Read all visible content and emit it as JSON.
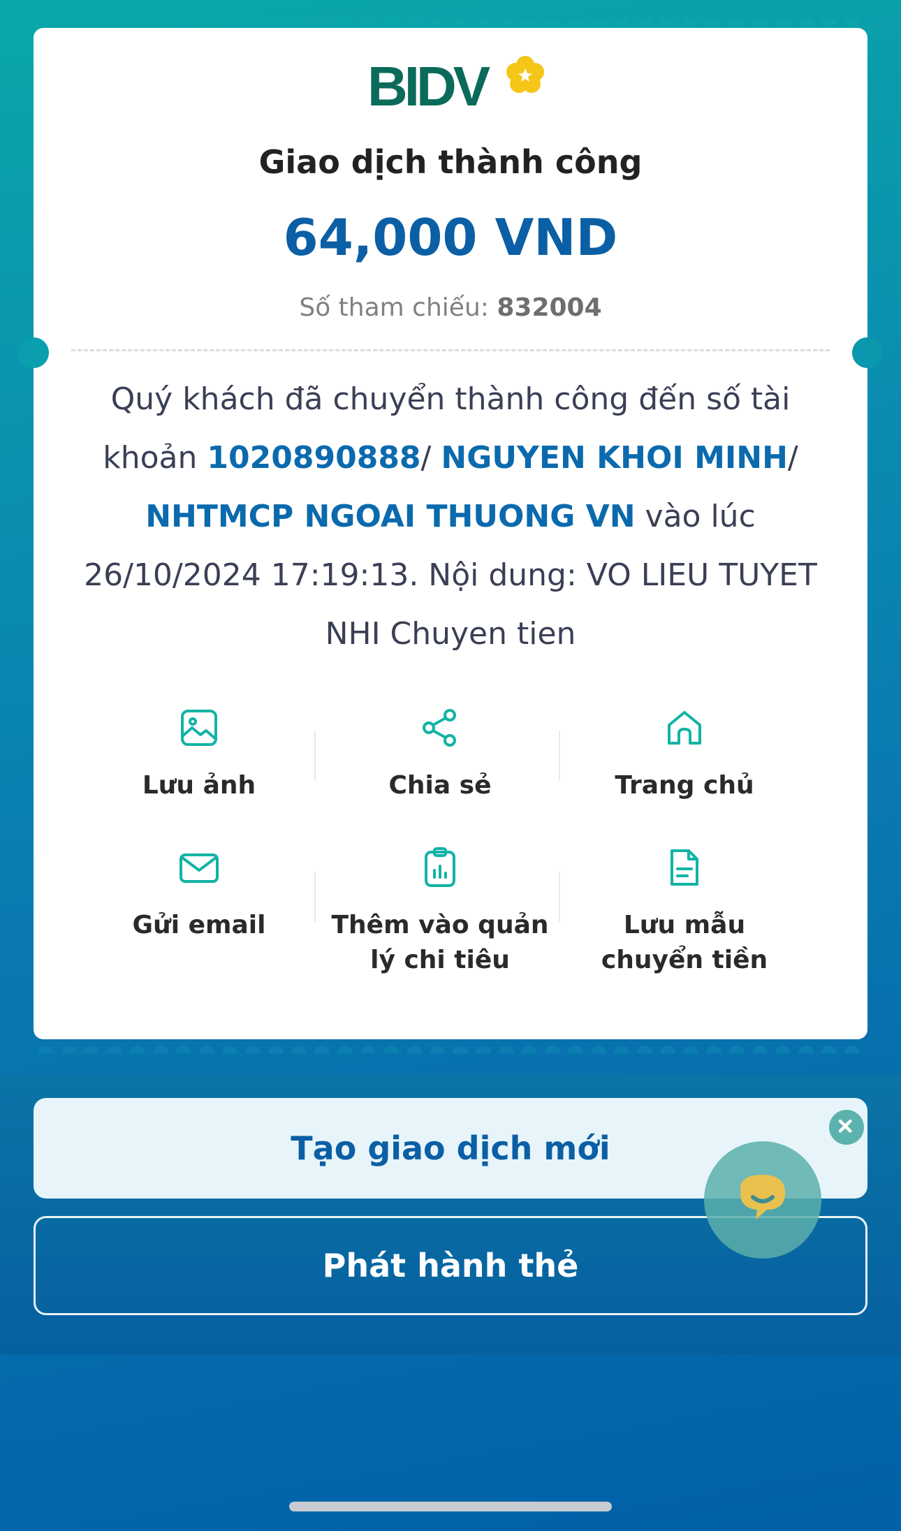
{
  "brand": {
    "name": "BIDV"
  },
  "receipt": {
    "title": "Giao dịch thành công",
    "amount": "64,000 VND",
    "reference_label": "Số tham chiếu:",
    "reference_value": "832004",
    "message": {
      "prefix": "Quý khách đã chuyển thành công đến số tài khoản ",
      "account": "1020890888",
      "sep1": "/ ",
      "recipient": "NGUYEN KHOI MINH",
      "sep2": "/ ",
      "bank": "NHTMCP NGOAI THUONG VN",
      "suffix": " vào lúc 26/10/2024 17:19:13. Nội dung: VO LIEU TUYET NHI Chuyen tien"
    }
  },
  "actions": [
    {
      "label": "Lưu ảnh",
      "icon": "image-icon"
    },
    {
      "label": "Chia sẻ",
      "icon": "share-icon"
    },
    {
      "label": "Trang chủ",
      "icon": "home-icon"
    },
    {
      "label": "Gửi email",
      "icon": "mail-icon"
    },
    {
      "label": "Thêm vào quản lý chi tiêu",
      "icon": "clipboard-chart-icon"
    },
    {
      "label": "Lưu mẫu chuyển tiền",
      "icon": "document-icon"
    }
  ],
  "buttons": {
    "new_transaction": "Tạo giao dịch mới",
    "issue_card": "Phát hành thẻ"
  },
  "colors": {
    "accent": "#0b5fa5",
    "icon_teal": "#12b3a4",
    "brand_green": "#0b6b5a",
    "brand_yellow": "#f5c518"
  }
}
